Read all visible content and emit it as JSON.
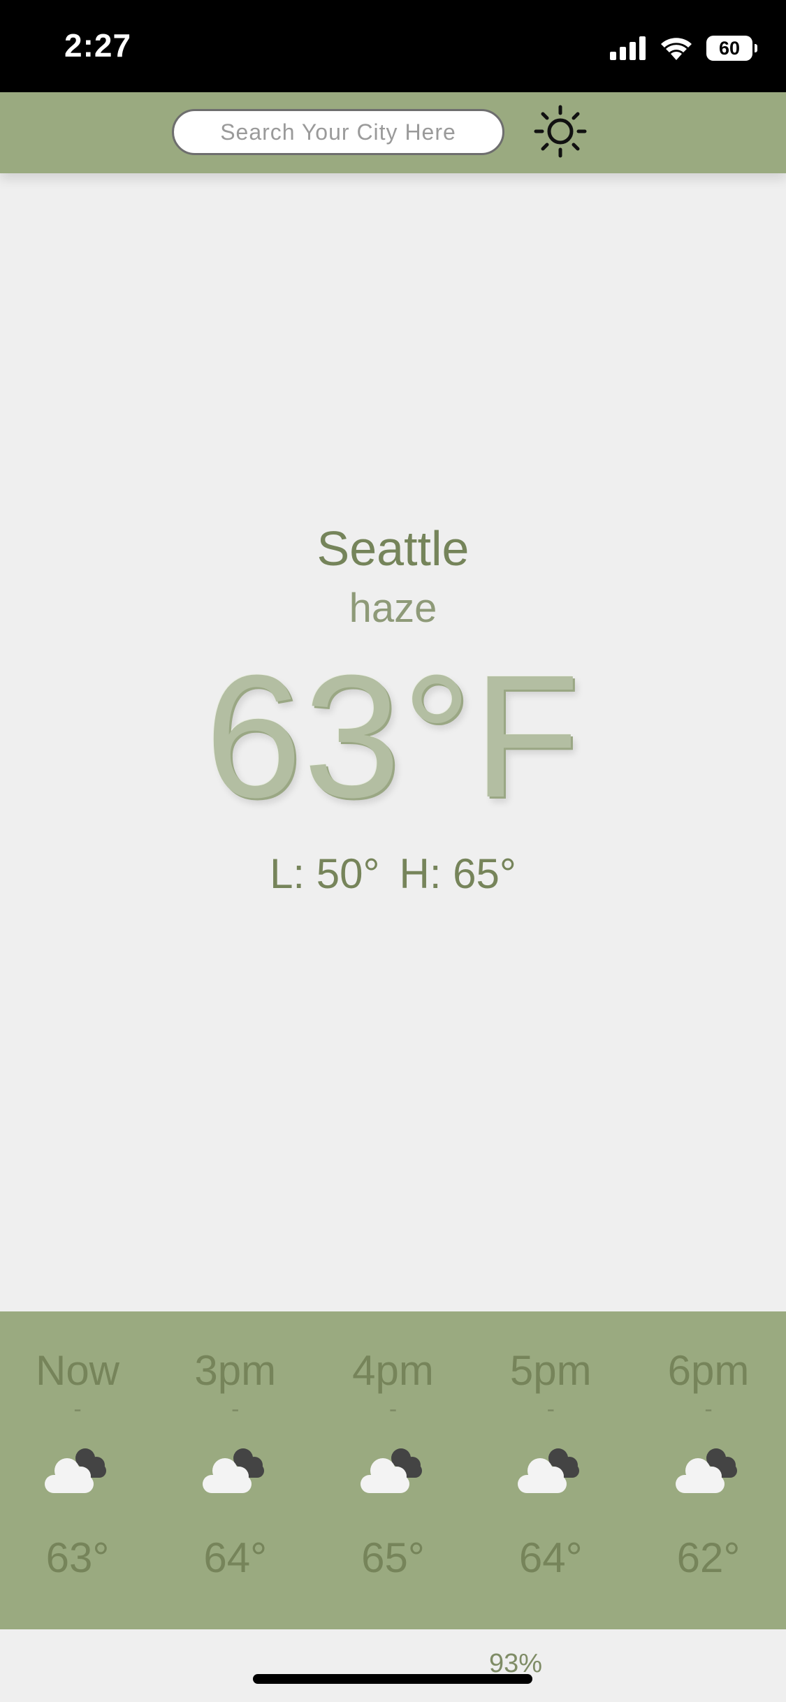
{
  "status_bar": {
    "time": "2:27",
    "battery": "60"
  },
  "header": {
    "search_placeholder": "Search Your City Here",
    "toggle_icon": "sun-icon"
  },
  "current": {
    "city": "Seattle",
    "condition": "haze",
    "temperature": "63°F",
    "low": "L: 50°",
    "high": "H: 65°"
  },
  "hourly": [
    {
      "label": "Now",
      "pop": "-",
      "icon": "partly-cloudy-icon",
      "temp": "63°"
    },
    {
      "label": "3pm",
      "pop": "-",
      "icon": "partly-cloudy-icon",
      "temp": "64°"
    },
    {
      "label": "4pm",
      "pop": "-",
      "icon": "partly-cloudy-icon",
      "temp": "65°"
    },
    {
      "label": "5pm",
      "pop": "-",
      "icon": "partly-cloudy-icon",
      "temp": "64°"
    },
    {
      "label": "6pm",
      "pop": "-",
      "icon": "partly-cloudy-icon",
      "temp": "62°"
    }
  ],
  "footer": {
    "humidity": "93%"
  },
  "colors": {
    "accent": "#9aaa80",
    "text": "#76845a",
    "background": "#efefef"
  }
}
